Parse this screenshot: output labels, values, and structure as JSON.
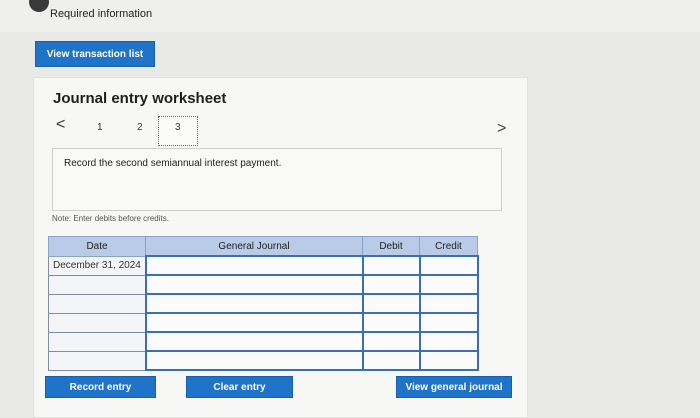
{
  "header": {
    "alert_symbol": "!",
    "required_label": "Required information"
  },
  "toolbar": {
    "view_transactions_label": "View transaction list"
  },
  "worksheet": {
    "title": "Journal entry worksheet",
    "nav_prev": "<",
    "nav_next": ">",
    "pages": [
      "1",
      "2",
      "3"
    ],
    "active_page": "3",
    "description": "Record the second semiannual interest payment.",
    "note": "Note: Enter debits before credits.",
    "columns": {
      "date": "Date",
      "general_journal": "General Journal",
      "debit": "Debit",
      "credit": "Credit"
    },
    "rows": [
      {
        "date": "December 31, 2024",
        "account": "",
        "debit": "",
        "credit": ""
      },
      {
        "date": "",
        "account": "",
        "debit": "",
        "credit": ""
      },
      {
        "date": "",
        "account": "",
        "debit": "",
        "credit": ""
      },
      {
        "date": "",
        "account": "",
        "debit": "",
        "credit": ""
      },
      {
        "date": "",
        "account": "",
        "debit": "",
        "credit": ""
      },
      {
        "date": "",
        "account": "",
        "debit": "",
        "credit": ""
      }
    ],
    "buttons": {
      "record": "Record entry",
      "clear": "Clear entry",
      "view_general_journal": "View general journal"
    }
  },
  "colors": {
    "accent_blue": "#1f73c8",
    "header_blue": "#b9cbe6",
    "background": "#e9e9e7"
  }
}
